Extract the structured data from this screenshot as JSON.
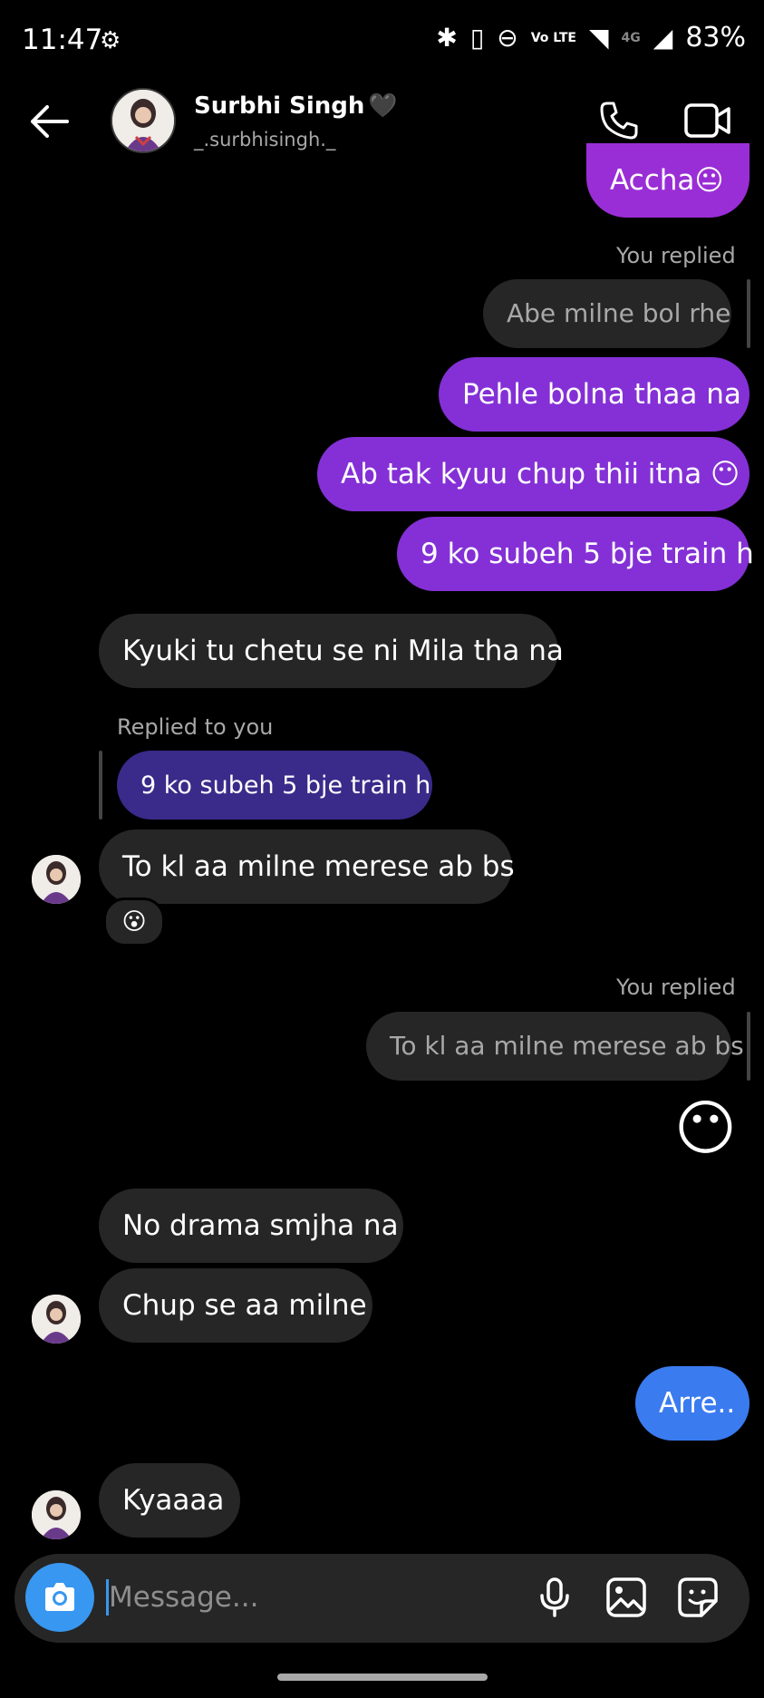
{
  "status_bar": {
    "time": "11:47",
    "lte_label": "Vo LTE",
    "network": "4G",
    "battery": "83%"
  },
  "header": {
    "name": "Surbhi Singh",
    "name_emoji": "🖤",
    "username": "_.surbhisingh._"
  },
  "messages": {
    "m1": "Accha😐",
    "you_replied_1": "You replied",
    "q1": "Abe milne bol rhe",
    "m2": "Pehle bolna thaa na",
    "m3": "Ab tak kyuu chup thii itna 😶",
    "m4": "9 ko subeh 5 bje train h",
    "m5": "Kyuki tu chetu se ni Mila tha na",
    "replied_to_you": "Replied to you",
    "q2": "9 ko subeh 5 bje train h",
    "m6": "To kl aa milne merese ab bs",
    "reaction_1": "😮",
    "you_replied_2": "You replied",
    "q3": "To kl aa milne merese ab bs",
    "m7": "😶",
    "m8": "No drama smjha na",
    "m9": "Chup se aa milne",
    "m10": "Arre..",
    "m11": "Kyaaaa"
  },
  "composer": {
    "placeholder": "Message..."
  },
  "colors": {
    "outgoing_bubble": "#8430d6",
    "incoming_bubble": "#262626",
    "blue_bubble": "#3a7bf0",
    "camera_button": "#3897f0"
  }
}
